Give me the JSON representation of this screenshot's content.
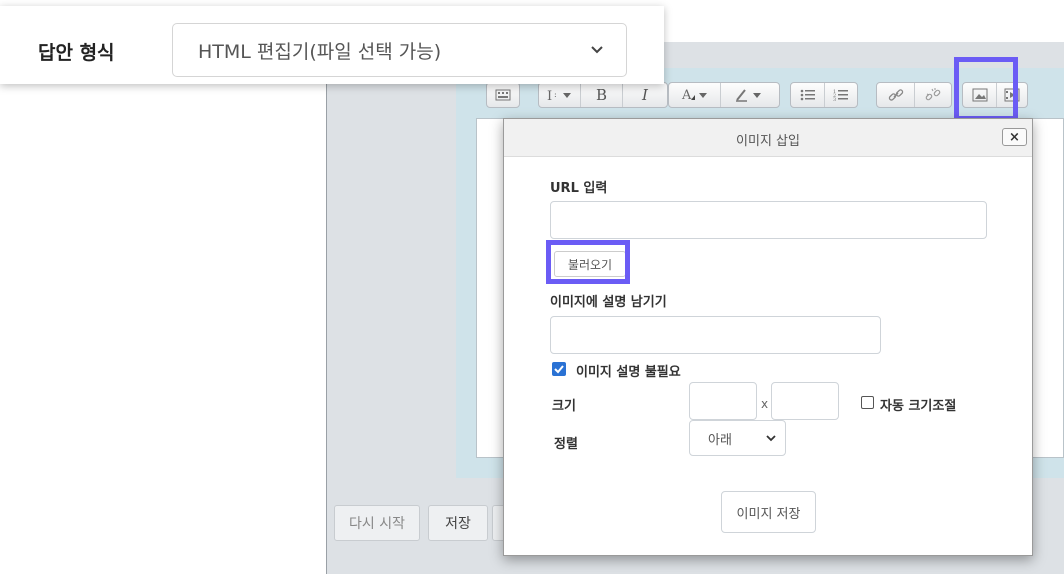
{
  "answer_format": {
    "label": "답안 형식",
    "selected_value": "HTML 편집기(파일 선택 가능)"
  },
  "toolbar": {
    "bold": "B",
    "italic": "I"
  },
  "bottom_buttons": {
    "restart": "다시 시작",
    "save": "저장"
  },
  "dialog": {
    "title": "이미지 삽입",
    "close": "×",
    "url_label": "URL 입력",
    "url_value": "",
    "load_button": "불러오기",
    "desc_label": "이미지에 설명 남기기",
    "desc_value": "",
    "no_desc_label": "이미지 설명 불필요",
    "no_desc_checked": true,
    "size_label": "크기",
    "size_separator": "x",
    "auto_resize_label": "자동 크기조절",
    "align_label": "정렬",
    "align_value": "아래",
    "save_button": "이미지 저장"
  },
  "colors": {
    "highlight": "#6b5cf5",
    "checkbox": "#2a72d4"
  }
}
